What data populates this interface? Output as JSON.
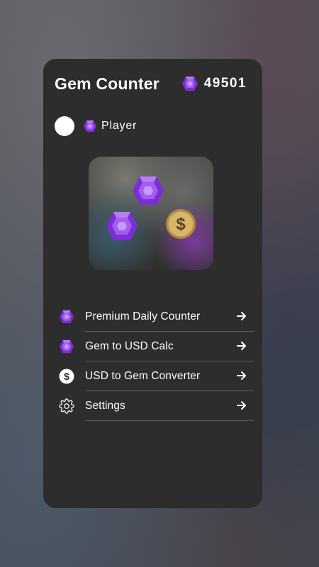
{
  "app": {
    "title": "Gem Counter"
  },
  "balance": {
    "value": "49501",
    "icon": "gem-icon"
  },
  "player": {
    "name": "Player",
    "badge_icon": "gem-icon"
  },
  "hero": {
    "coin_symbol": "$"
  },
  "menu": {
    "items": [
      {
        "label": "Premium Daily Counter",
        "icon": "gem-icon"
      },
      {
        "label": "Gem to USD Calc",
        "icon": "gem-icon"
      },
      {
        "label": "USD to Gem Converter",
        "icon": "dollar-icon"
      },
      {
        "label": "Settings",
        "icon": "gear-icon"
      }
    ]
  },
  "colors": {
    "card": "#2c2d2c",
    "gem_purple": "#8a3fe0",
    "coin_gold": "#d9b56a"
  }
}
